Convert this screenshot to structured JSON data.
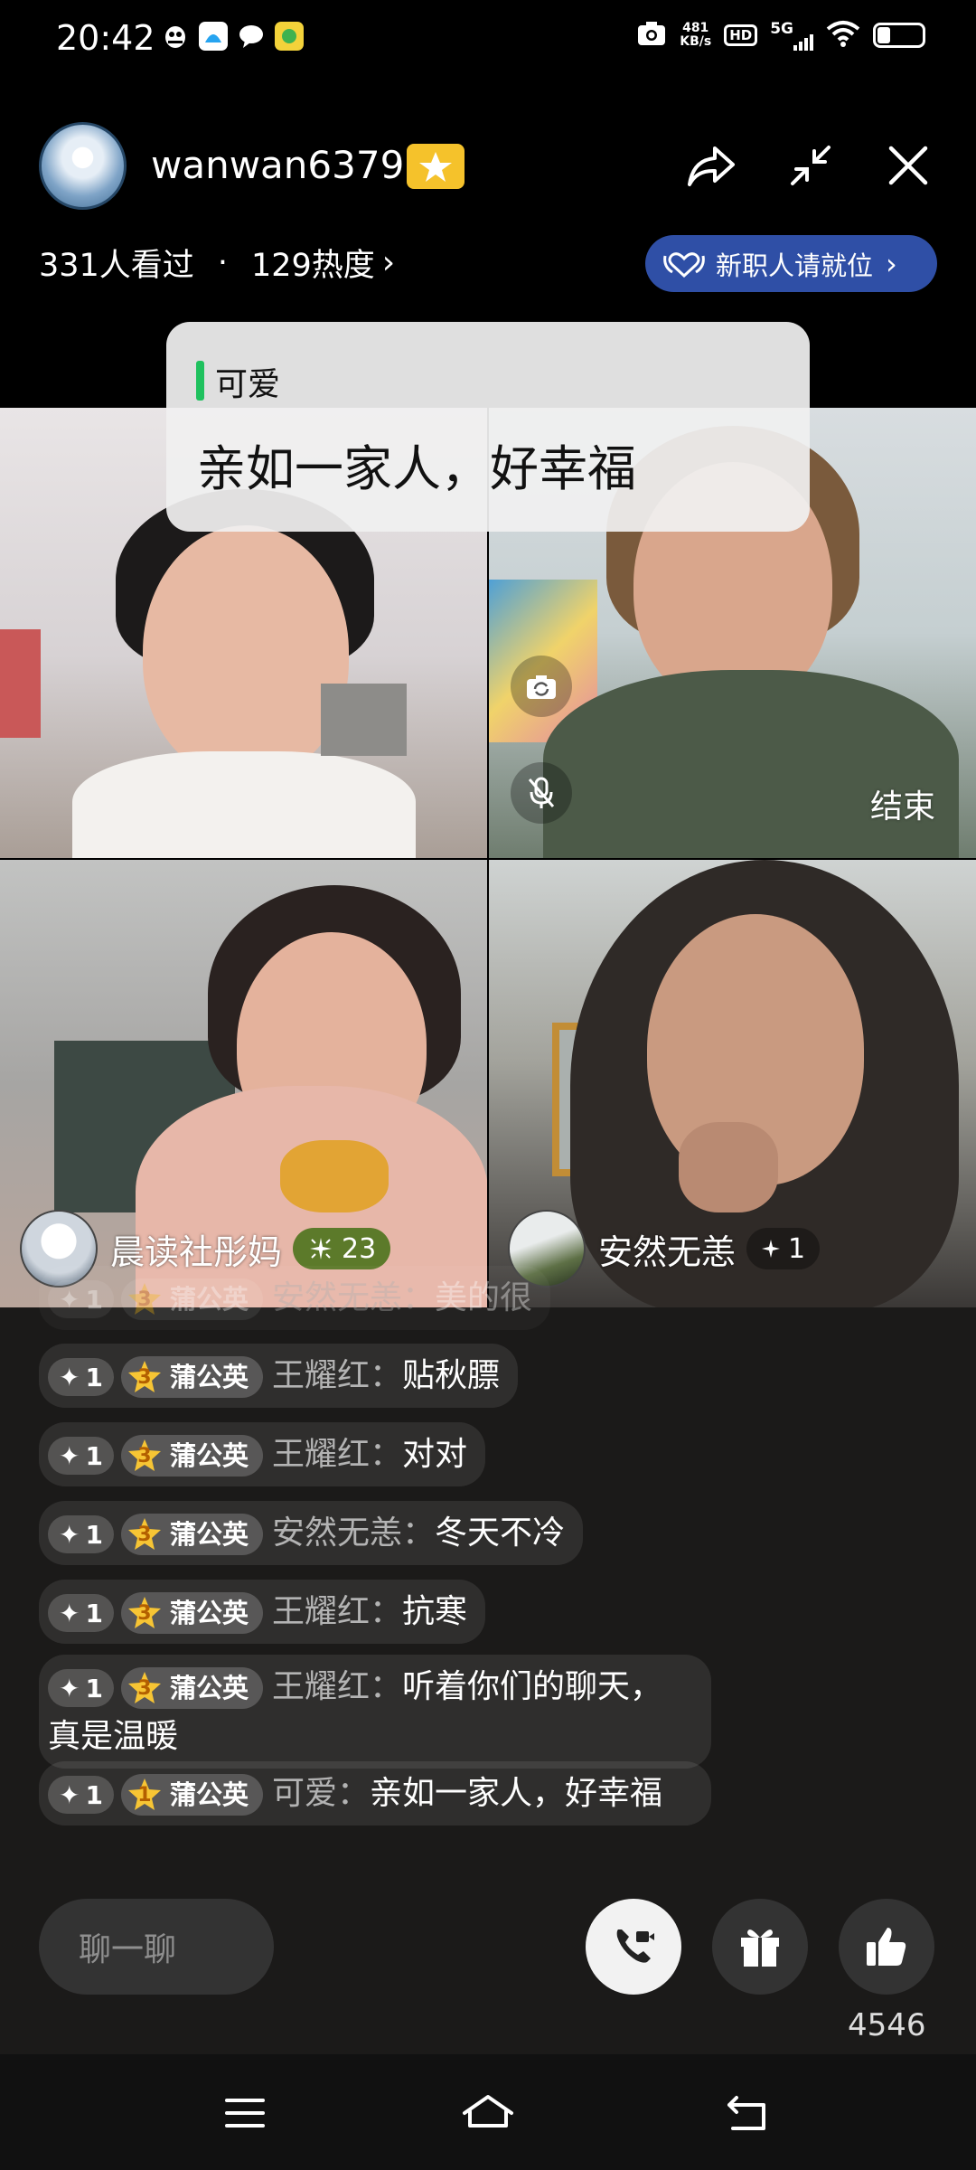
{
  "status_bar": {
    "time": "20:42",
    "net_speed_value": "481",
    "net_speed_unit": "KB/s",
    "hd": "HD",
    "network": "5G",
    "app_icons": [
      "qq-penguin-icon",
      "app-blue-icon",
      "message-bubble-icon",
      "app-green-icon"
    ]
  },
  "header": {
    "host_name": "wanwan6379",
    "stats": {
      "viewers": "331人看过",
      "separator": "·",
      "heat": "129热度"
    },
    "recruit_button": "新职人请就位",
    "icons": [
      "share-icon",
      "minimize-icon",
      "close-icon"
    ]
  },
  "popup": {
    "user": "可爱",
    "text": "亲如一家人，好幸福"
  },
  "videos": {
    "end_label": "结束",
    "tags": [
      {
        "name": "晨读社彤妈",
        "count": "23"
      },
      {
        "name": "安然无恙",
        "count": "1"
      }
    ]
  },
  "chat": {
    "messages": [
      {
        "plus": "1",
        "level": "3",
        "fan": "蒲公英",
        "user": "安然无恙：",
        "text": "美的很"
      },
      {
        "plus": "1",
        "level": "3",
        "fan": "蒲公英",
        "user": "王耀红：",
        "text": "贴秋膘"
      },
      {
        "plus": "1",
        "level": "3",
        "fan": "蒲公英",
        "user": "王耀红：",
        "text": "对对"
      },
      {
        "plus": "1",
        "level": "3",
        "fan": "蒲公英",
        "user": "安然无恙：",
        "text": "冬天不冷"
      },
      {
        "plus": "1",
        "level": "3",
        "fan": "蒲公英",
        "user": "王耀红：",
        "text": "抗寒"
      },
      {
        "plus": "1",
        "level": "3",
        "fan": "蒲公英",
        "user": "王耀红：",
        "text": "听着你们的聊天，真是温暖"
      },
      {
        "plus": "1",
        "level": "1",
        "fan": "蒲公英",
        "user": "可爱：",
        "text": "亲如一家人，好幸福"
      }
    ]
  },
  "bottom": {
    "chat_placeholder": "聊一聊",
    "like_count": "4546"
  },
  "colors": {
    "background": "#000000",
    "chat_background": "#1b1a19",
    "recruit_blue": "#2f4fa6",
    "badge_gold": "#f5c22b",
    "popup_accent": "#1fc15e",
    "pill_green": "#5c7a2a"
  }
}
